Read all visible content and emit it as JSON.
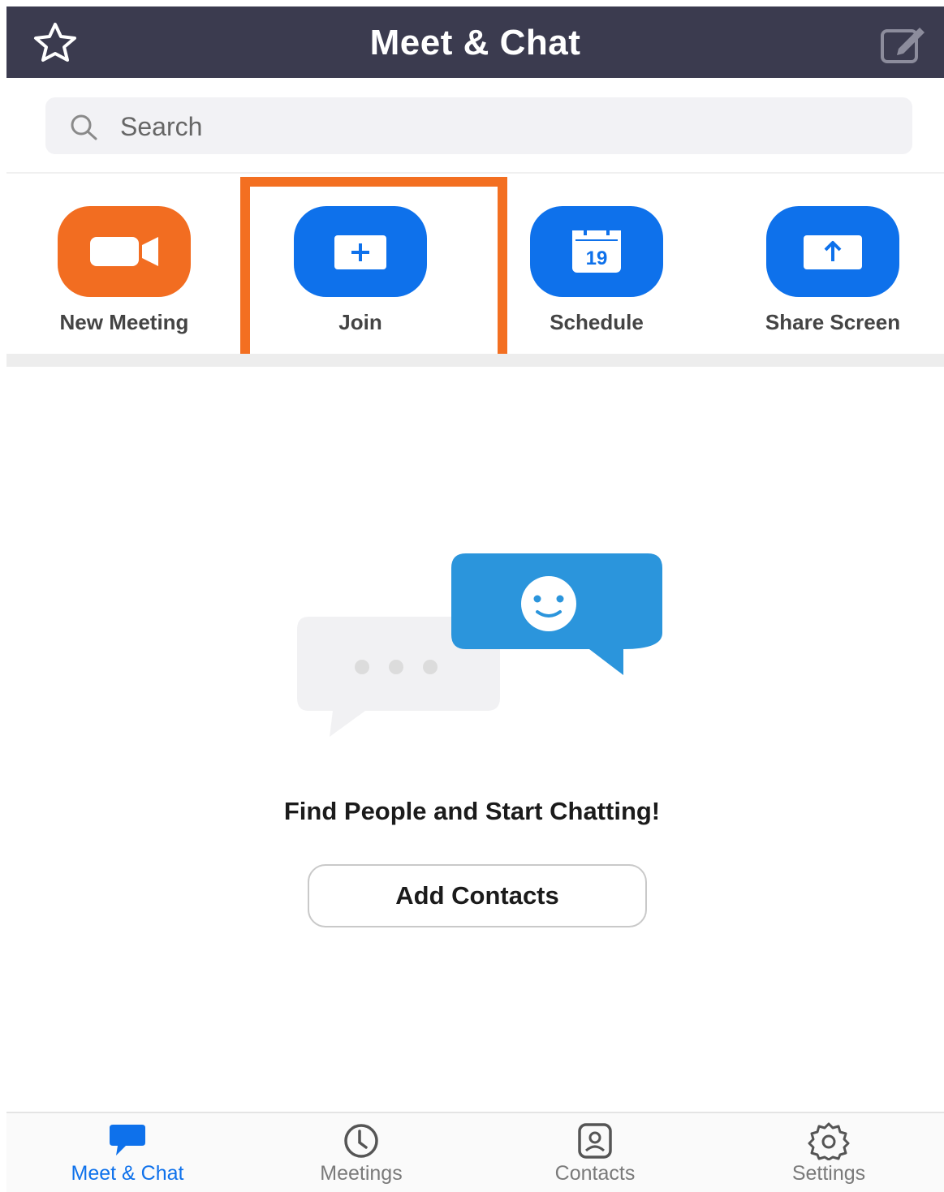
{
  "header": {
    "title": "Meet & Chat",
    "left_icon": "star-icon",
    "right_icon": "compose-icon"
  },
  "search": {
    "placeholder": "Search",
    "value": ""
  },
  "actions": [
    {
      "label": "New Meeting",
      "icon": "video-camera-icon",
      "color": "#f26d21"
    },
    {
      "label": "Join",
      "icon": "plus-icon",
      "color": "#0e71eb",
      "highlighted": true
    },
    {
      "label": "Schedule",
      "icon": "calendar-icon",
      "color": "#0e71eb",
      "calendar_day": "19"
    },
    {
      "label": "Share Screen",
      "icon": "upload-arrow-icon",
      "color": "#0e71eb"
    }
  ],
  "highlight_color": "#f36f21",
  "empty_state": {
    "title": "Find People and Start Chatting!",
    "button_label": "Add Contacts"
  },
  "bottom_nav": [
    {
      "label": "Meet & Chat",
      "icon": "chat-bubble-icon",
      "active": true
    },
    {
      "label": "Meetings",
      "icon": "clock-icon",
      "active": false
    },
    {
      "label": "Contacts",
      "icon": "contact-card-icon",
      "active": false
    },
    {
      "label": "Settings",
      "icon": "gear-icon",
      "active": false
    }
  ],
  "colors": {
    "header_bg": "#3b3b4f",
    "accent": "#0e71eb",
    "orange": "#f26d21"
  }
}
